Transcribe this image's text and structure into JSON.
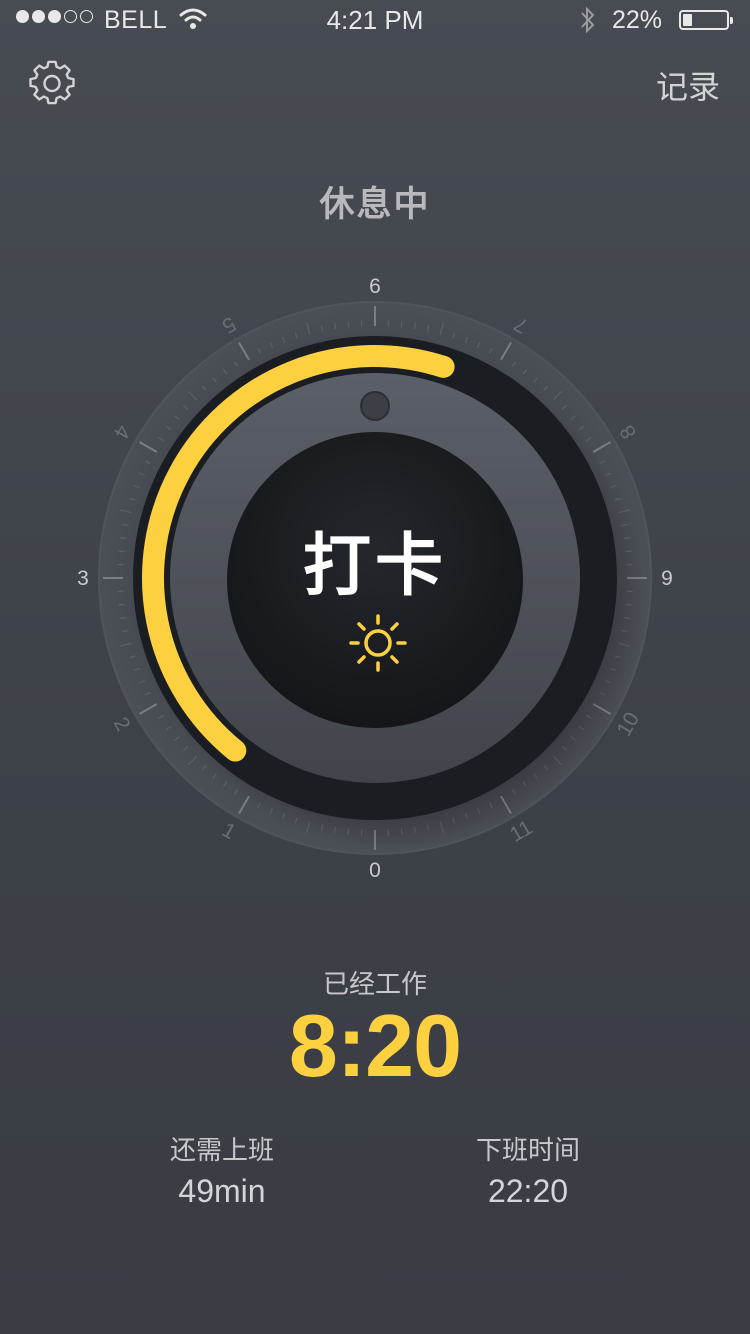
{
  "status_bar": {
    "signal_full": 3,
    "signal_total": 5,
    "carrier": "BELL",
    "time": "4:21 PM",
    "battery": "22%",
    "battery_level": 0.22
  },
  "header": {
    "settings_icon": "gear-icon",
    "records_label": "记录"
  },
  "state_label": "休息中",
  "dial": {
    "button_label": "打卡",
    "button_icon": "sun-icon",
    "hour_labels": [
      "0",
      "1",
      "2",
      "3",
      "4",
      "5",
      "6",
      "7",
      "8",
      "9",
      "10",
      "11"
    ],
    "progress_color": "#fdd03f",
    "progress_start_hour": 1.3,
    "progress_end_hour": 6.6
  },
  "worked": {
    "label": "已经工作",
    "value": "8:20"
  },
  "stats": {
    "remaining_label": "还需上班",
    "remaining_value": "49min",
    "offwork_label": "下班时间",
    "offwork_value": "22:20"
  },
  "colors": {
    "accent": "#fdd03f",
    "background": "#41444b"
  }
}
